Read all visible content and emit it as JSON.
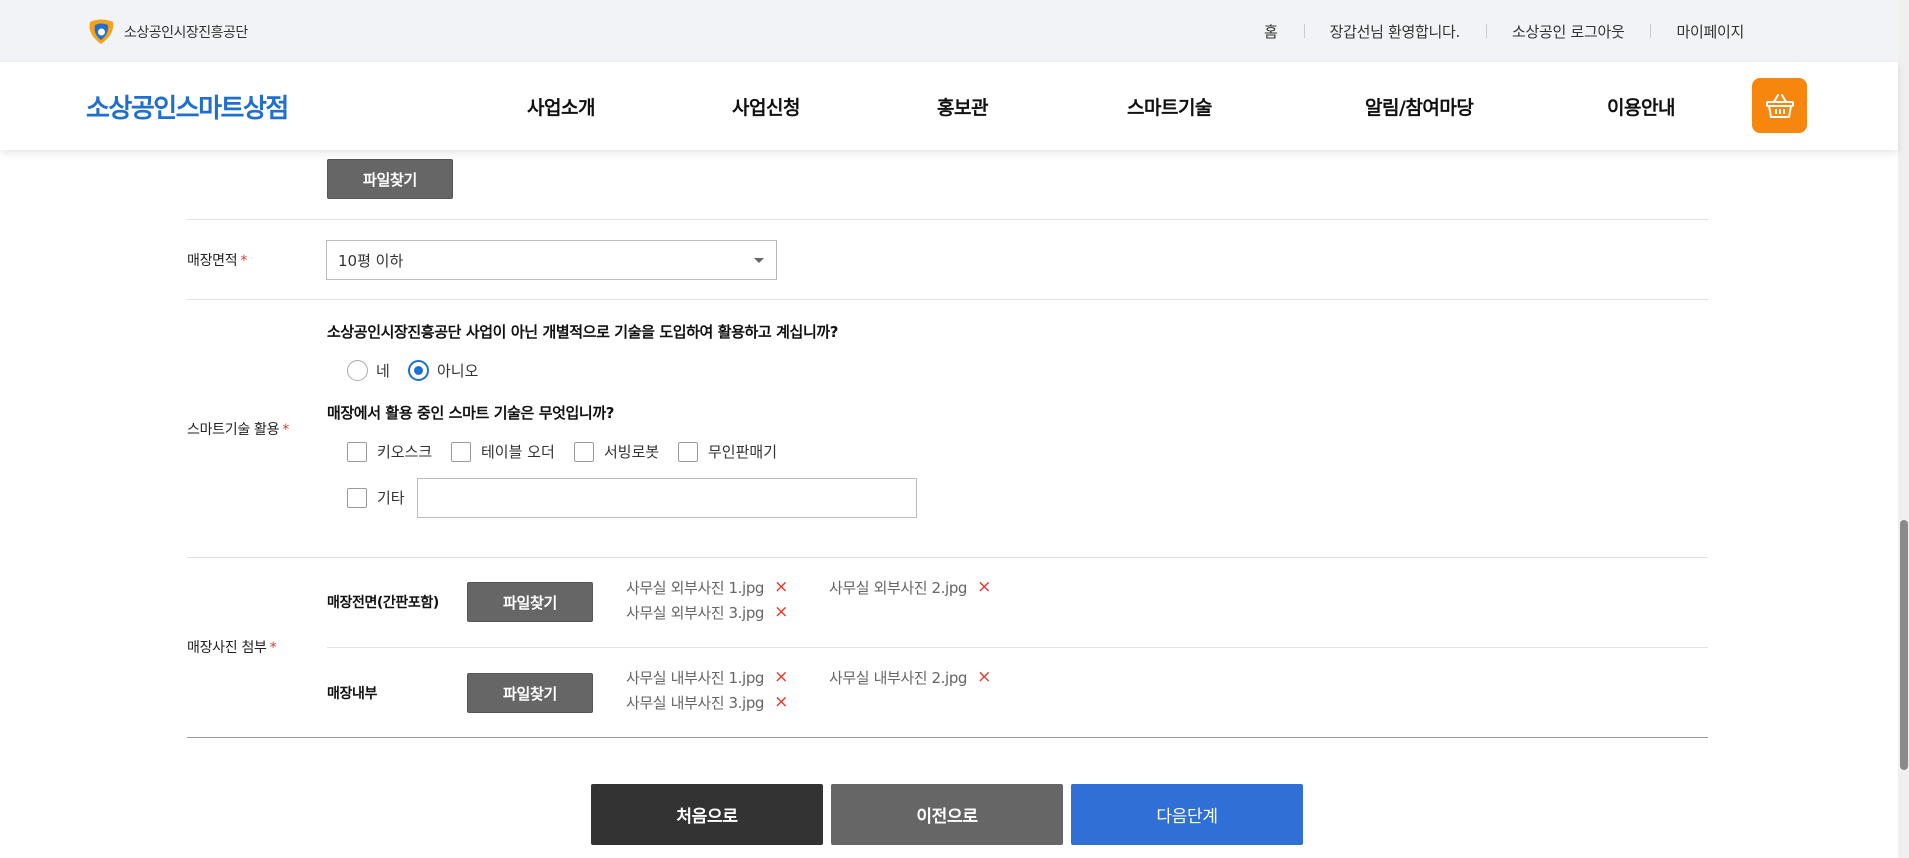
{
  "util_bar": {
    "org_name": "소상공인시장진흥공단",
    "links": [
      "홈",
      "장갑선님 환영합니다.",
      "소상공인 로그아웃",
      "마이페이지"
    ]
  },
  "header": {
    "brand": "소상공인스마트상점",
    "menus": [
      "사업소개",
      "사업신청",
      "홍보관",
      "스마트기술",
      "알림/참여마당",
      "이용안내"
    ],
    "cart_icon": "basket-icon",
    "accent": "#f7860f",
    "brand_color": "#1f6fcf"
  },
  "form": {
    "top_file_button": "파일찾기",
    "store_area": {
      "label": "매장면적",
      "required_mark": "*",
      "selected": "10평 이하"
    },
    "smart_tech": {
      "label": "스마트기술 활용",
      "required_mark": "*",
      "question1": "소상공인시장진흥공단 사업이 아닌 개별적으로 기술을 도입하여 활용하고 계십니까?",
      "radios": [
        {
          "label": "네",
          "checked": false
        },
        {
          "label": "아니오",
          "checked": true
        }
      ],
      "question2": "매장에서 활용 중인 스마트 기술은 무엇입니까?",
      "checkboxes": [
        "키오스크",
        "테이블 오더",
        "서빙로봇",
        "무인판매기"
      ],
      "etc_label": "기타",
      "etc_value": ""
    },
    "photos": {
      "label": "매장사진 첨부",
      "required_mark": "*",
      "front": {
        "label": "매장전면(간판포함)",
        "button": "파일찾기",
        "files": [
          "사무실 외부사진 1.jpg",
          "사무실 외부사진 2.jpg",
          "사무실 외부사진 3.jpg"
        ]
      },
      "inside": {
        "label": "매장내부",
        "button": "파일찾기",
        "files": [
          "사무실 내부사진 1.jpg",
          "사무실 내부사진 2.jpg",
          "사무실 내부사진 3.jpg"
        ]
      },
      "remove_mark": "×"
    }
  },
  "buttons": {
    "first": "처음으로",
    "prev": "이전으로",
    "next": "다음단계",
    "colors": {
      "first": "#333333",
      "prev": "#666666",
      "next": "#2f6fd6"
    }
  }
}
